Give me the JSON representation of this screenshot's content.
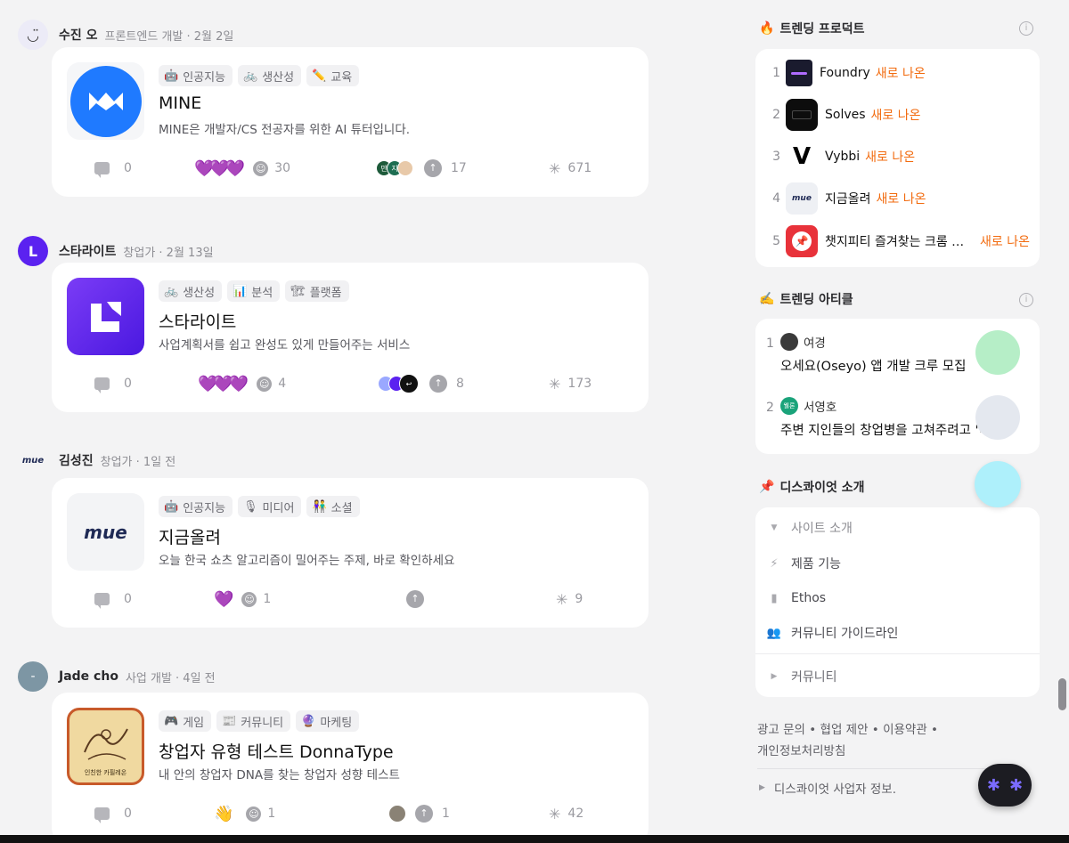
{
  "posts": [
    {
      "author": "수진 오",
      "meta": "프론트엔드 개발 · 2월 2일",
      "avatar_glyph": "◡̈",
      "tags": [
        {
          "icon": "🤖",
          "label": "인공지능"
        },
        {
          "icon": "🚲",
          "label": "생산성"
        },
        {
          "icon": "✏️",
          "label": "교육"
        }
      ],
      "title": "MINE",
      "desc": "MINE은 개발자/CS 전공자를 위한 AI 튜터입니다.",
      "comments": "0",
      "hearts": "💜💜💜",
      "smile": "30",
      "upvotes": "17",
      "clicks": "671",
      "thumb_text": "M",
      "thumb_color": "#1f7aff"
    },
    {
      "author": "스타라이트",
      "meta": "창업가 · 2월 13일",
      "avatar_glyph": "L",
      "tags": [
        {
          "icon": "🚲",
          "label": "생산성"
        },
        {
          "icon": "📊",
          "label": "분석"
        },
        {
          "icon": "🏗",
          "label": "플랫폼"
        }
      ],
      "title": "스타라이트",
      "desc": "사업계획서를 쉽고 완성도 있게 만들어주는 서비스",
      "comments": "0",
      "hearts": "💜💜💜",
      "smile": "4",
      "upvotes": "8",
      "clicks": "173",
      "thumb_text": "L",
      "thumb_color": "#6b2cf5"
    },
    {
      "author": "김성진",
      "meta": "창업가 · 1일 전",
      "avatar_glyph": "mue",
      "tags": [
        {
          "icon": "🤖",
          "label": "인공지능"
        },
        {
          "icon": "🎙",
          "label": "미디어"
        },
        {
          "icon": "👫",
          "label": "소셜"
        }
      ],
      "title": "지금올려",
      "desc": "오늘 한국 쇼츠 알고리즘이 밀어주는 주제, 바로 확인하세요",
      "comments": "0",
      "hearts": "💜",
      "smile": "1",
      "upvotes": "",
      "clicks": "9",
      "thumb_text": "mue",
      "thumb_color": "#f3f4f6"
    },
    {
      "author": "Jade cho",
      "meta": "사업 개발 · 4일 전",
      "avatar_glyph": "-",
      "tags": [
        {
          "icon": "🎮",
          "label": "게임"
        },
        {
          "icon": "📰",
          "label": "커뮤니티"
        },
        {
          "icon": "🔮",
          "label": "마케팅"
        }
      ],
      "title": "창업자 유형 테스트 DonnaType",
      "desc": "내 안의 창업자 DNA를 찾는 창업자 성향 테스트",
      "comments": "0",
      "hearts": "👋",
      "smile": "1",
      "upvotes": "1",
      "clicks": "42",
      "thumb_text": "인친한 카필레온",
      "thumb_color": "#f0d9a0"
    }
  ],
  "sidebar": {
    "trending_products": {
      "title": "트렌딩 프로덕트",
      "icon": "🔥",
      "items": [
        {
          "rank": "1",
          "name": "Foundry",
          "badge": "새로 나온",
          "logo_color": "#1a1b2e"
        },
        {
          "rank": "2",
          "name": "Solves",
          "badge": "새로 나온",
          "logo_color": "#0d0d0d"
        },
        {
          "rank": "3",
          "name": "Vybbi",
          "badge": "새로 나온",
          "logo_color": "#ffffff"
        },
        {
          "rank": "4",
          "name": "지금올려",
          "badge": "새로 나온",
          "logo_color": "#eef0f4"
        },
        {
          "rank": "5",
          "name": "챗지피티 즐겨찾는 크롬 확...",
          "badge": "새로 나온",
          "logo_color": "#e8323a"
        }
      ]
    },
    "trending_articles": {
      "title": "트렌딩 아티클",
      "icon": "✍️",
      "items": [
        {
          "rank": "1",
          "author": "여경",
          "title": "오세요(Oseyo) 앱 개발 크루 모집",
          "av_color": "#3a3a3a"
        },
        {
          "rank": "2",
          "author": "서영호",
          "title": "주변 지인들의 창업병을 고쳐주려고 '극딜 ...",
          "av_color": "#1aa37a",
          "av_text": "웰론"
        }
      ]
    },
    "discoid_intro": {
      "title": "디스콰이엇 소개",
      "icon": "📌",
      "site_intro": "사이트 소개",
      "items": [
        {
          "icon": "⚡",
          "label": "제품 기능"
        },
        {
          "icon": "▮",
          "label": "Ethos"
        },
        {
          "icon": "👥",
          "label": "커뮤니티 가이드라인"
        }
      ],
      "community": "커뮤니티"
    },
    "footer_links": [
      "광고 문의",
      "협업 제안",
      "이용약관",
      "개인정보처리방침"
    ],
    "biz_info": "디스콰이엇 사업자 정보."
  },
  "colors": {
    "accent_orange": "#f26b0f",
    "heart_purple": "#9b30e8"
  }
}
